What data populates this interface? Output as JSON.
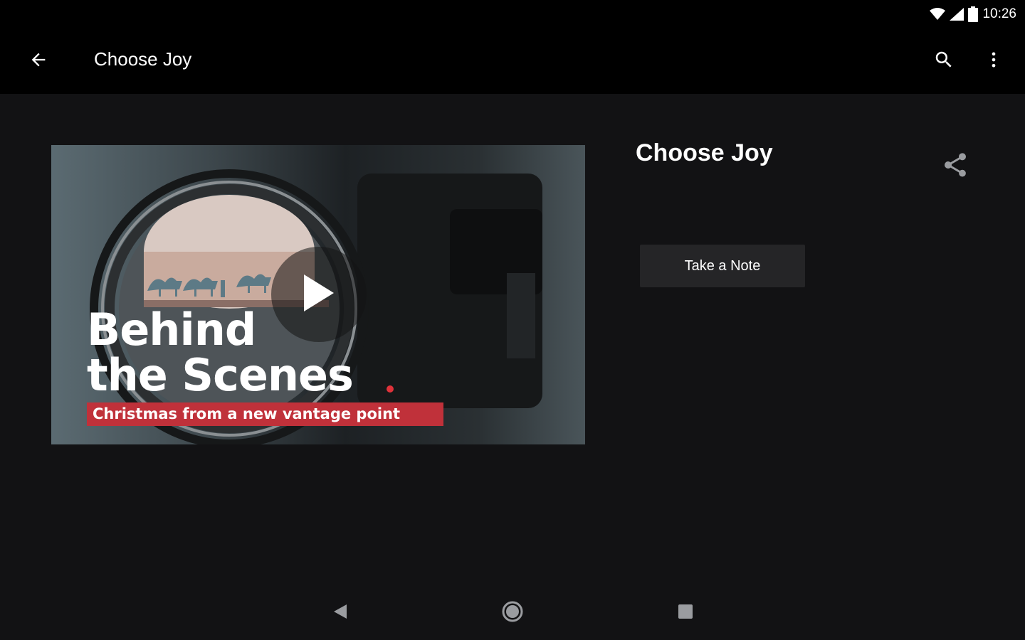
{
  "status_bar": {
    "time": "10:26",
    "icons": [
      "wifi-icon",
      "signal-icon",
      "battery-icon"
    ]
  },
  "app_bar": {
    "title": "Choose Joy",
    "icons": [
      "back-arrow-icon",
      "search-icon",
      "more-vert-icon"
    ]
  },
  "media": {
    "title": "Choose Joy",
    "thumbnail": {
      "title": "Behind\nthe Scenes",
      "subtitle": "Christmas from a new vantage point",
      "accent_color": "#c0313a"
    },
    "icons": [
      "play-icon",
      "share-icon"
    ]
  },
  "actions": {
    "take_note_label": "Take a Note"
  },
  "nav_bar": {
    "icons": [
      "nav-back-icon",
      "nav-home-icon",
      "nav-recents-icon"
    ]
  },
  "colors": {
    "background": "#121214",
    "bar": "#000000",
    "button": "#252527",
    "accent": "#c0313a"
  }
}
